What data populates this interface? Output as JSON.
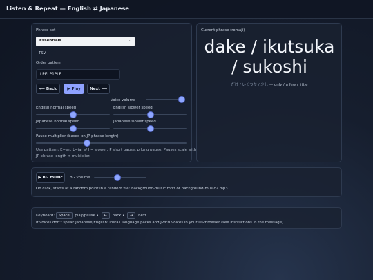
{
  "app": {
    "title": "Listen & Repeat — English ⇄ Japanese"
  },
  "left_panel": {
    "phrase_set_label": "Phrase set",
    "phrase_set_value": "Essentials",
    "tsv_label": "TSV",
    "order_pattern_label": "Order pattern",
    "order_pattern_value": "LPELP1PLP",
    "buttons": {
      "back": "⟵ Back",
      "play": "▶ Play",
      "next": "Next ⟶"
    },
    "voice_volume_label": "Voice volume",
    "voice_volume_level": 0.92,
    "english_normal_label": "English normal speed",
    "english_normal_level": 0.5,
    "english_slower_label": "English slower speed",
    "english_slower_level": 0.5,
    "japanese_normal_label": "Japanese normal speed",
    "japanese_normal_level": 0.5,
    "japanese_slower_label": "Japanese slower speed",
    "japanese_slower_level": 0.5,
    "pause_multiplier_label": "Pause multiplier (based on JP phrase length)",
    "pause_multiplier_level": 0.34,
    "help_line1": "Use pattern: E=en, L=ja, e/ l = slower; P short pause, p long pause. Pauses scale with",
    "help_line2": "JP phrase length × multiplier."
  },
  "right_panel": {
    "label": "Current phrase (romaji)",
    "romaji_line1": "dake / ikutsuka",
    "romaji_line2": "/ sukoshi",
    "kana": "だけ / いくつか / 少し",
    "english": "— only / a few / little"
  },
  "music": {
    "bg_music_button": "▶ BG music",
    "bg_volume_label": "BG volume",
    "bg_volume_level": 0.45,
    "note": "On click, starts at a random point in a random file: background-music.mp3 or background-music2.mp3."
  },
  "keyboard": {
    "label": "Keyboard:",
    "space_key": "Space",
    "space_action": "play/pause •",
    "left_key": "←",
    "left_action": "back •",
    "right_key": "→",
    "right_action": "next",
    "note": "If voices don't speak Japanese/English: install language packs and JP/EN voices in your OS/browser (see instructions in the message)."
  },
  "colors": {
    "accent": "#8fa2ff",
    "background": "#161e2e",
    "panel": "#192131"
  }
}
